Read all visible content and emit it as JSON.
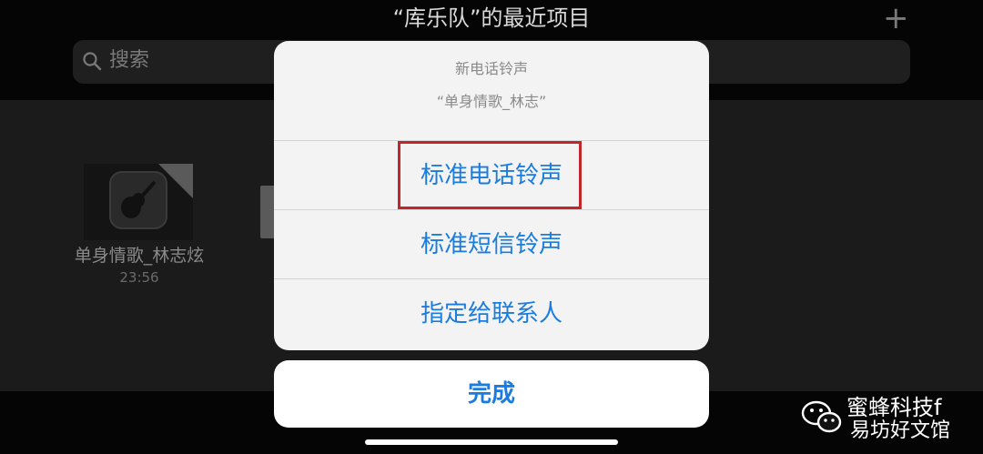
{
  "header": {
    "title": "“库乐队”的最近项目",
    "add_icon": "plus-icon"
  },
  "search": {
    "placeholder": "搜索",
    "icon": "search-icon"
  },
  "projects": [
    {
      "name": "单身情歌_林志炫",
      "time": "23:56",
      "icon": "guitar-icon"
    }
  ],
  "sheet": {
    "title": "新电话铃声",
    "subtitle": "“单身情歌_林志”",
    "options": [
      {
        "label": "标准电话铃声",
        "highlighted": true
      },
      {
        "label": "标准短信铃声"
      },
      {
        "label": "指定给联系人"
      }
    ],
    "done_label": "完成"
  },
  "watermark": {
    "line1": "蜜蜂科技f",
    "line2": "易坊好文馆",
    "icon": "wechat-icon"
  },
  "colors": {
    "accent": "#1b7ce0",
    "highlight_border": "#c0262a",
    "sheet_bg": "#f3f3f3"
  }
}
